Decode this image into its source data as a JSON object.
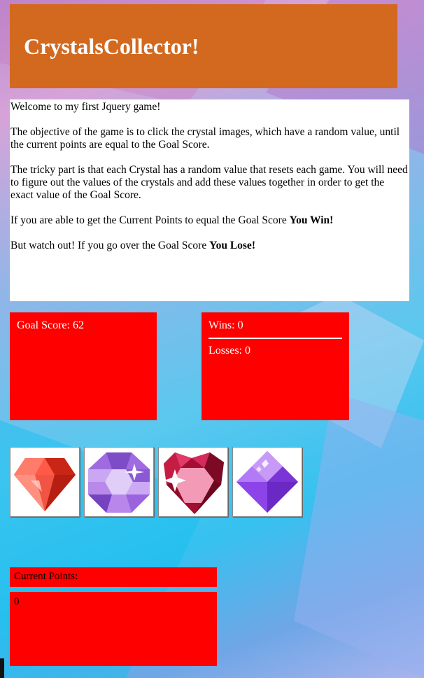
{
  "header": {
    "title": "CrystalsCollector!"
  },
  "intro": {
    "welcome": "Welcome to my first Jquery game!",
    "objective": "The objective of the game is to click the crystal images, which have a random value, until the current points are equal to the Goal Score.",
    "tricky": "The tricky part is that each Crystal has a random value that resets each game. You will need to figure out the values of the crystals and add these values together in order to get the exact value of the Goal Score.",
    "win_prefix": "If you are able to get the Current Points to equal the Goal Score ",
    "win_bold": "You Win!",
    "lose_prefix": "But watch out! If you go over the Goal Score ",
    "lose_bold": "You Lose!"
  },
  "goal": {
    "text": "Goal Score: 62"
  },
  "stats": {
    "wins": "Wins: 0",
    "losses": "Losses: 0"
  },
  "crystals": [
    {
      "name": "red-diamond-crystal",
      "color": "#e53a2a"
    },
    {
      "name": "purple-round-crystal",
      "color": "#a06be0"
    },
    {
      "name": "ruby-heart-crystal",
      "color": "#c0143c"
    },
    {
      "name": "violet-octagon-crystal",
      "color": "#9a4ff0"
    }
  ],
  "current": {
    "label": "Current Points:",
    "value": "0"
  },
  "colors": {
    "header": "#d2691e",
    "box": "#ff0000"
  }
}
